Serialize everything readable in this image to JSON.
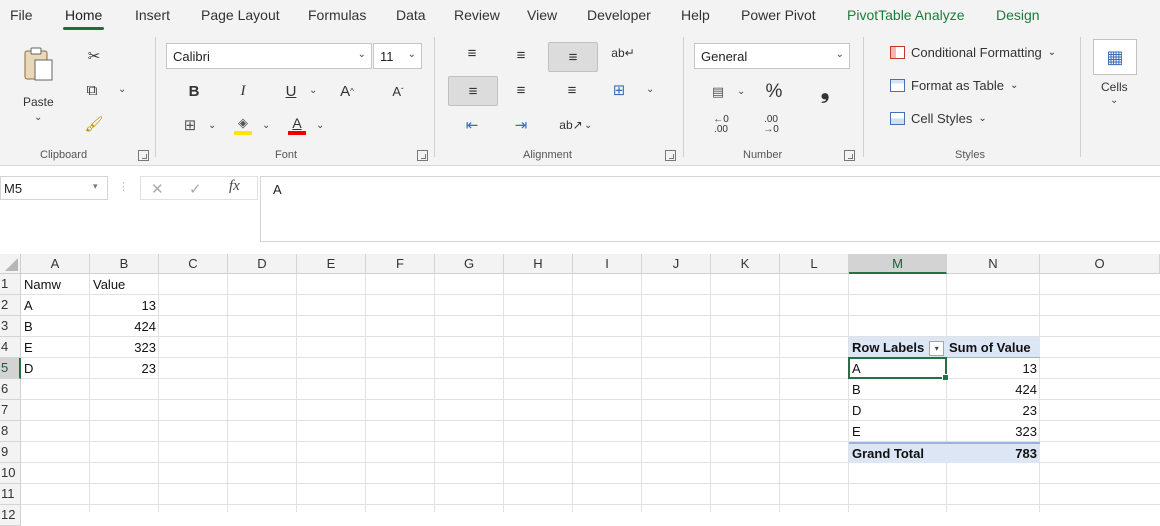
{
  "menu": {
    "tabs": [
      "File",
      "Home",
      "Insert",
      "Page Layout",
      "Formulas",
      "Data",
      "Review",
      "View",
      "Developer",
      "Help",
      "Power Pivot",
      "PivotTable Analyze",
      "Design"
    ],
    "active": "Home"
  },
  "ribbon": {
    "clipboard": {
      "paste_label": "Paste",
      "group_label": "Clipboard"
    },
    "font": {
      "name": "Calibri",
      "size": "11",
      "bold": "B",
      "italic": "I",
      "underline": "U",
      "grow": "A",
      "shrink": "A",
      "group_label": "Font"
    },
    "alignment": {
      "group_label": "Alignment"
    },
    "number": {
      "format": "General",
      "percent": "%",
      "comma": "9",
      "inc_dec": "←.0\n.00",
      "dec_dec": ".00\n→.0",
      "group_label": "Number"
    },
    "styles": {
      "conditional": "Conditional Formatting",
      "format_table": "Format as Table",
      "cell_styles": "Cell Styles",
      "group_label": "Styles"
    },
    "cells": {
      "label": "Cells"
    }
  },
  "formula_bar": {
    "name_box": "M5",
    "formula": "A",
    "fx": "fx"
  },
  "sheet": {
    "columns": [
      "A",
      "B",
      "C",
      "D",
      "E",
      "F",
      "G",
      "H",
      "I",
      "J",
      "K",
      "L",
      "M",
      "N",
      "O"
    ],
    "rows": [
      "1",
      "2",
      "3",
      "4",
      "5",
      "6",
      "7",
      "8",
      "9",
      "10",
      "11",
      "12"
    ],
    "selected_col": "M",
    "selected_row": "5",
    "data": {
      "header": [
        "Namw",
        "Value"
      ],
      "rows": [
        [
          "A",
          "13"
        ],
        [
          "B",
          "424"
        ],
        [
          "E",
          "323"
        ],
        [
          "D",
          "23"
        ]
      ]
    },
    "pivot": {
      "header": [
        "Row Labels",
        "Sum of Value"
      ],
      "rows": [
        [
          "A",
          "13"
        ],
        [
          "B",
          "424"
        ],
        [
          "D",
          "23"
        ],
        [
          "E",
          "323"
        ]
      ],
      "total": [
        "Grand Total",
        "783"
      ]
    }
  },
  "colors": {
    "accent": "#217346",
    "pivot_header": "#dde6f5",
    "pivot_border": "#9bb3dc"
  }
}
